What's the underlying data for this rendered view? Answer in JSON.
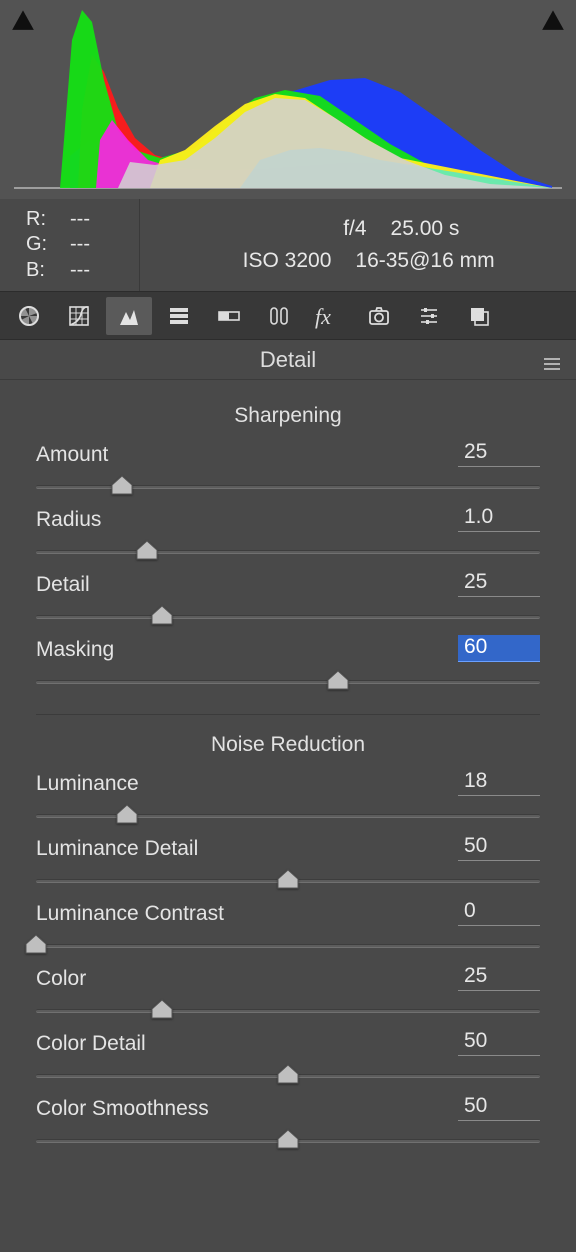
{
  "histogram": {
    "clip_left_icon": "clip-shadow-icon",
    "clip_right_icon": "clip-highlight-icon"
  },
  "rgb": {
    "r_label": "R:",
    "r_value": "---",
    "g_label": "G:",
    "g_value": "---",
    "b_label": "B:",
    "b_value": "---"
  },
  "exif": {
    "aperture": "f/4",
    "shutter": "25.00 s",
    "iso": "ISO 3200",
    "lens": "16-35@16 mm"
  },
  "tabs": [
    {
      "id": "basic",
      "icon": "aperture-icon",
      "active": false
    },
    {
      "id": "tone-curve",
      "icon": "grid-icon",
      "active": false
    },
    {
      "id": "detail",
      "icon": "detail-icon",
      "active": true
    },
    {
      "id": "hsl",
      "icon": "bars-icon",
      "active": false
    },
    {
      "id": "split-toning",
      "icon": "split-icon",
      "active": false
    },
    {
      "id": "lens",
      "icon": "lens-icon",
      "active": false
    },
    {
      "id": "fx",
      "icon": "fx-icon",
      "active": false
    },
    {
      "id": "camera",
      "icon": "camera-icon",
      "active": false
    },
    {
      "id": "calibration",
      "icon": "sliders-icon",
      "active": false
    },
    {
      "id": "presets",
      "icon": "stack-icon",
      "active": false
    }
  ],
  "section": {
    "title": "Detail"
  },
  "sharpening": {
    "title": "Sharpening",
    "amount": {
      "label": "Amount",
      "value": "25",
      "pct": 17
    },
    "radius": {
      "label": "Radius",
      "value": "1.0",
      "pct": 22
    },
    "detail": {
      "label": "Detail",
      "value": "25",
      "pct": 25
    },
    "masking": {
      "label": "Masking",
      "value": "60",
      "pct": 60,
      "selected": true
    }
  },
  "noise": {
    "title": "Noise Reduction",
    "luminance": {
      "label": "Luminance",
      "value": "18",
      "pct": 18
    },
    "luminance_detail": {
      "label": "Luminance Detail",
      "value": "50",
      "pct": 50
    },
    "luminance_contrast": {
      "label": "Luminance Contrast",
      "value": "0",
      "pct": 0
    },
    "color": {
      "label": "Color",
      "value": "25",
      "pct": 25
    },
    "color_detail": {
      "label": "Color Detail",
      "value": "50",
      "pct": 50
    },
    "color_smoothness": {
      "label": "Color Smoothness",
      "value": "50",
      "pct": 50
    }
  }
}
